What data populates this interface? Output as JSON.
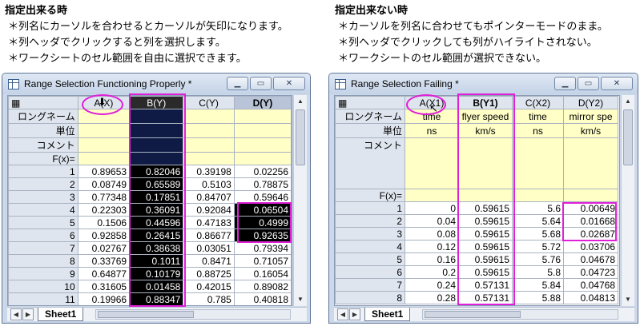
{
  "notes_left": {
    "heading": "指定出来る時",
    "lines": [
      "＊列名にカーソルを合わせるとカーソルが矢印になります。",
      "＊列ヘッダでクリックすると列を選択します。",
      "＊ワークシートのセル範囲を自由に選択できます。"
    ]
  },
  "notes_right": {
    "heading": "指定出来ない時",
    "lines": [
      "＊カーソルを列名に合わせてもポインターモードのまま。",
      "＊列ヘッダでクリックしても列がハイライトされない。",
      "＊ワークシートのセル範囲が選択できない。"
    ]
  },
  "left_window": {
    "title": "Range Selection Functioning Properly *",
    "columns": [
      "A(X)",
      "B(Y)",
      "C(Y)",
      "D(Y)"
    ],
    "meta_labels": [
      "ロングネーム",
      "単位",
      "コメント",
      "F(x)="
    ],
    "rows": [
      [
        "1",
        "0.89653",
        "0.82046",
        "0.39198",
        "0.02256"
      ],
      [
        "2",
        "0.08749",
        "0.65589",
        "0.5103",
        "0.78875"
      ],
      [
        "3",
        "0.77348",
        "0.17851",
        "0.84707",
        "0.59646"
      ],
      [
        "4",
        "0.22303",
        "0.36091",
        "0.92084",
        "0.06504"
      ],
      [
        "5",
        "0.1506",
        "0.44596",
        "0.47183",
        "0.4999"
      ],
      [
        "6",
        "0.92858",
        "0.26415",
        "0.86677",
        "0.92635"
      ],
      [
        "7",
        "0.02767",
        "0.38638",
        "0.03051",
        "0.79394"
      ],
      [
        "8",
        "0.33769",
        "0.1011",
        "0.8471",
        "0.71057"
      ],
      [
        "9",
        "0.64877",
        "0.10179",
        "0.88725",
        "0.16054"
      ],
      [
        "10",
        "0.31605",
        "0.01458",
        "0.42015",
        "0.89082"
      ],
      [
        "11",
        "0.19966",
        "0.88347",
        "0.785",
        "0.40818"
      ]
    ],
    "sheet_tab": "Sheet1"
  },
  "right_window": {
    "title": "Range Selection Failing *",
    "columns": [
      "A(X1)",
      "B(Y1)",
      "C(X2)",
      "D(Y2)"
    ],
    "meta_labels": [
      "ロングネーム",
      "単位",
      "コメント",
      "F(x)="
    ],
    "longnames": [
      "time",
      "flyer speed",
      "time",
      "mirror spe"
    ],
    "units": [
      "ns",
      "km/s",
      "ns",
      "km/s"
    ],
    "rows": [
      [
        "1",
        "0",
        "0.59615",
        "5.6",
        "0.00649"
      ],
      [
        "2",
        "0.04",
        "0.59615",
        "5.64",
        "0.01668"
      ],
      [
        "3",
        "0.08",
        "0.59615",
        "5.68",
        "0.02687"
      ],
      [
        "4",
        "0.12",
        "0.59615",
        "5.72",
        "0.03706"
      ],
      [
        "5",
        "0.16",
        "0.59615",
        "5.76",
        "0.04678"
      ],
      [
        "6",
        "0.2",
        "0.59615",
        "5.8",
        "0.04723"
      ],
      [
        "7",
        "0.24",
        "0.57131",
        "5.84",
        "0.04768"
      ],
      [
        "8",
        "0.28",
        "0.57131",
        "5.88",
        "0.04813"
      ]
    ],
    "sheet_tab": "Sheet1"
  },
  "icons": {
    "app": "worksheet-icon",
    "minimize": "minimize-icon",
    "restore": "restore-icon",
    "close": "close-icon",
    "corner": "grid-select-icon"
  },
  "colors": {
    "highlight": "#e020d8",
    "selection": "#000000",
    "meta_rows": "#ffffc6",
    "header": "#dfe5ee"
  }
}
